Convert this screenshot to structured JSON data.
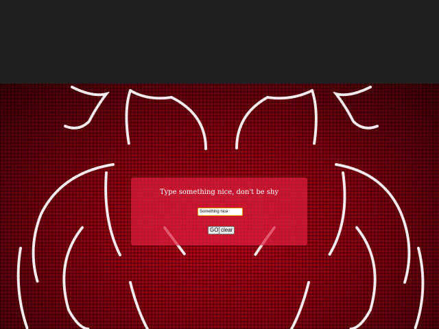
{
  "dialog": {
    "title": "Type something nice, don't be shy",
    "input_value": "Something nice",
    "go_label": "GO!",
    "clear_label": "clear"
  },
  "colors": {
    "top_band": "#1e1e1e",
    "background_red": "#c1001a",
    "neon_stroke": "#ffffff",
    "dialog_bg": "#dc1e3c"
  },
  "background": {
    "description_icon": "neon-face-photo"
  }
}
